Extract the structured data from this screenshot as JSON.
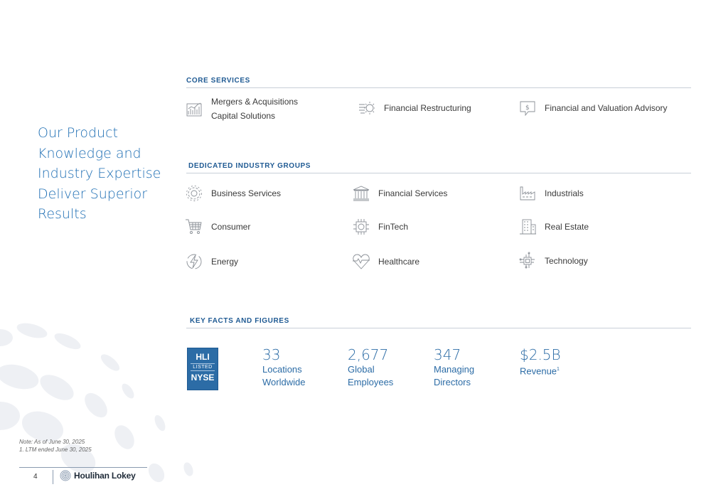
{
  "headline": [
    "Our Product",
    "Knowledge and",
    "Industry Expertise",
    "Deliver Superior",
    "Results"
  ],
  "core_services": {
    "title": "CORE SERVICES",
    "items": [
      {
        "icon": "chart-icon",
        "lines": [
          "Mergers & Acquisitions",
          "Capital Solutions"
        ]
      },
      {
        "icon": "restructuring-icon",
        "label": "Financial Restructuring"
      },
      {
        "icon": "dollar-speech-icon",
        "label": "Financial and Valuation Advisory"
      }
    ]
  },
  "industry_groups": {
    "title": "DEDICATED INDUSTRY GROUPS",
    "items": [
      {
        "icon": "gear-icon",
        "label": "Business Services"
      },
      {
        "icon": "bank-icon",
        "label": "Financial Services"
      },
      {
        "icon": "factory-icon",
        "label": "Industrials"
      },
      {
        "icon": "cart-icon",
        "label": "Consumer"
      },
      {
        "icon": "fintech-icon",
        "label": "FinTech"
      },
      {
        "icon": "building-icon",
        "label": "Real Estate"
      },
      {
        "icon": "energy-icon",
        "label": "Energy"
      },
      {
        "icon": "heart-icon",
        "label": "Healthcare"
      },
      {
        "icon": "chip-icon",
        "label": "Technology"
      }
    ]
  },
  "key_facts": {
    "title": "KEY FACTS AND FIGURES",
    "badge": {
      "top": "HLI",
      "middle": "LISTED",
      "bottom": "NYSE"
    },
    "facts": [
      {
        "value": "33",
        "lines": [
          "Locations",
          "Worldwide"
        ]
      },
      {
        "value": "2,677",
        "lines": [
          "Global",
          "Employees"
        ]
      },
      {
        "value": "347",
        "lines": [
          "Managing",
          "Directors"
        ]
      },
      {
        "value": "$2.5B",
        "lines": [
          "Revenue"
        ],
        "footnote": "1"
      }
    ]
  },
  "notes": [
    "Note: As of June 30, 2025",
    "1. LTM ended June 30, 2025"
  ],
  "footer": {
    "page": "4",
    "company": "Houlihan Lokey"
  },
  "colors": {
    "accent": "#1f6fb4",
    "heading": "#1f5a93",
    "icon": "#8a8f96",
    "deco": "#eef0f4"
  }
}
